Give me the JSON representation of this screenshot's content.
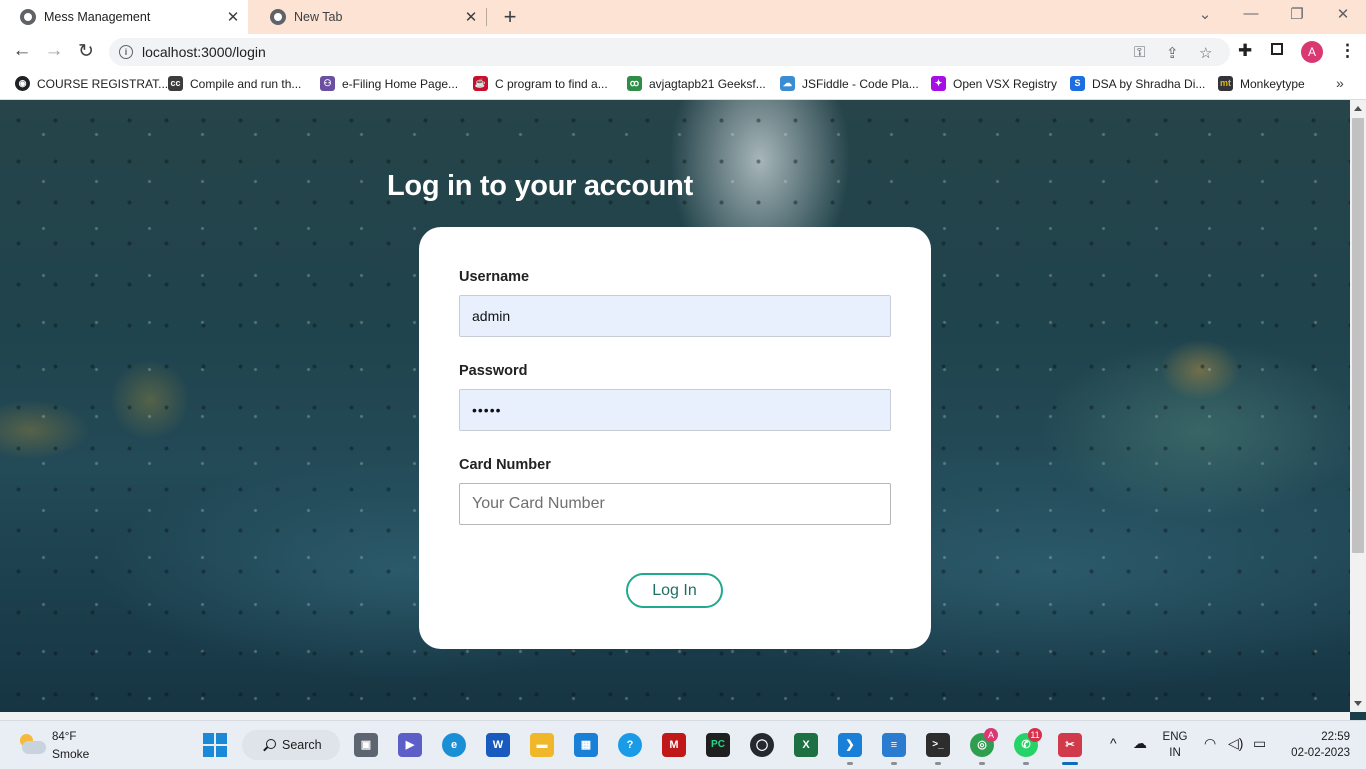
{
  "browser": {
    "tabs": [
      {
        "title": "Mess Management",
        "active": true,
        "close": "✕"
      },
      {
        "title": "New Tab",
        "active": false,
        "close": "✕"
      }
    ],
    "new_tab_symbol": "+",
    "window_controls": {
      "tab_search": "⌄",
      "minimize": "—",
      "restore": "❐",
      "close": "✕"
    },
    "nav": {
      "back": "←",
      "forward": "→",
      "reload": "↻"
    },
    "url": "localhost:3000/login",
    "omnibox_icons": {
      "key": "key-icon",
      "share": "share-icon",
      "bookmark": "star-icon"
    },
    "toolbar_icons": {
      "extensions": "puzzle-icon",
      "side_panel": "side-panel-icon",
      "menu": "⋮"
    },
    "profile_initial": "A",
    "bookmarks": [
      {
        "label": "COURSE REGISTRAT...",
        "icon": "globe",
        "color": "#202124",
        "glyph": "◉"
      },
      {
        "label": "Compile and run th...",
        "icon": "cc",
        "color": "#3c3c3c",
        "glyph": "cc"
      },
      {
        "label": "e-Filing Home Page...",
        "icon": "efiling",
        "color": "#6b4fa0",
        "glyph": "⚇"
      },
      {
        "label": "C program to find a...",
        "icon": "cup",
        "color": "#c8102e",
        "glyph": "☕"
      },
      {
        "label": "avjagtapb21 Geeksf...",
        "icon": "gfg",
        "color": "#2f8d46",
        "glyph": "ꝏ"
      },
      {
        "label": "JSFiddle - Code Pla...",
        "icon": "cloud",
        "color": "#3b8dd1",
        "glyph": "☁"
      },
      {
        "label": "Open VSX Registry",
        "icon": "vsx",
        "color": "#a60ee5",
        "glyph": "✦"
      },
      {
        "label": "DSA by Shradha Di...",
        "icon": "s",
        "color": "#1d6ee0",
        "glyph": "S"
      },
      {
        "label": "Monkeytype",
        "icon": "mt",
        "color": "#323437",
        "glyph": "mt"
      }
    ],
    "bookmarks_more": "»"
  },
  "page": {
    "heading": "Log in to your account",
    "form": {
      "username": {
        "label": "Username",
        "value": "admin",
        "placeholder": ""
      },
      "password": {
        "label": "Password",
        "value": "•••••",
        "placeholder": ""
      },
      "card_number": {
        "label": "Card Number",
        "value": "",
        "placeholder": "Your Card Number"
      },
      "submit_label": "Log In"
    }
  },
  "taskbar": {
    "weather": {
      "temp": "84°F",
      "desc": "Smoke"
    },
    "search_label": "Search",
    "apps": [
      {
        "name": "task-view",
        "glyph": "▣",
        "color": "#5d6670"
      },
      {
        "name": "teams-meet",
        "glyph": "▶",
        "color": "#5b5fc7"
      },
      {
        "name": "edge",
        "glyph": "e",
        "color": "#1b8fd6"
      },
      {
        "name": "word",
        "glyph": "W",
        "color": "#185abd"
      },
      {
        "name": "file-explorer",
        "glyph": "▬",
        "color": "#f1b72b"
      },
      {
        "name": "microsoft-store",
        "glyph": "▦",
        "color": "#1a7fd6"
      },
      {
        "name": "get-help",
        "glyph": "?",
        "color": "#1a9be8"
      },
      {
        "name": "mcafee",
        "glyph": "M",
        "color": "#c01818"
      },
      {
        "name": "pycharm",
        "glyph": "PC",
        "color": "#1f1f1f"
      },
      {
        "name": "github",
        "glyph": "◯",
        "color": "#24292f"
      },
      {
        "name": "excel",
        "glyph": "X",
        "color": "#1d7044"
      },
      {
        "name": "vscode",
        "glyph": "❯",
        "color": "#1a7fd6"
      },
      {
        "name": "notepad",
        "glyph": "≡",
        "color": "#2b7bd1"
      },
      {
        "name": "terminal",
        "glyph": ">_",
        "color": "#2d2d2d"
      },
      {
        "name": "chrome",
        "glyph": "◎",
        "color": "#2f9e4f"
      },
      {
        "name": "whatsapp",
        "glyph": "✆",
        "color": "#25d366"
      },
      {
        "name": "snipping-tool",
        "glyph": "✂",
        "color": "#d13a4a"
      }
    ],
    "chrome_badge": "A",
    "whatsapp_badge": "11",
    "tray": {
      "overflow": "^",
      "lang_top": "ENG",
      "lang_bottom": "IN",
      "time": "22:59",
      "date": "02-02-2023"
    }
  }
}
